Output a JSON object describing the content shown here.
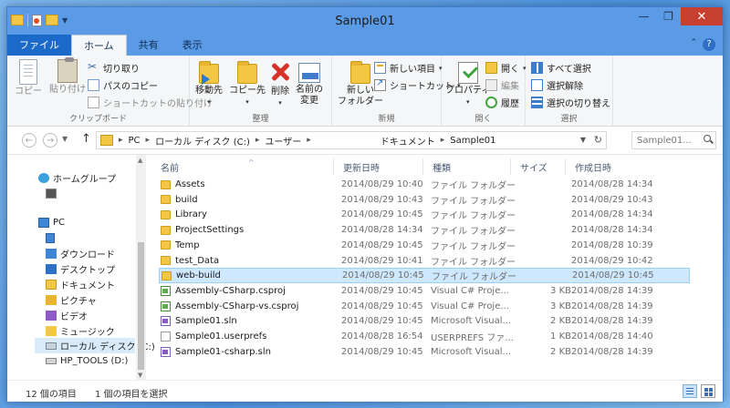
{
  "window": {
    "title": "Sample01",
    "minimize": "—",
    "maximize": "❐",
    "close": "✕"
  },
  "ribbon_tabs": [
    "ファイル",
    "ホーム",
    "共有",
    "表示"
  ],
  "ribbon": {
    "clipboard": {
      "label": "クリップボード",
      "copy": "コピー",
      "paste": "貼り付け",
      "cut": "切り取り",
      "copy_path": "パスのコピー",
      "paste_shortcut": "ショートカットの貼り付け"
    },
    "organize": {
      "label": "整理",
      "move_to": "移動先",
      "copy_to": "コピー先",
      "delete": "削除",
      "rename_1": "名前の",
      "rename_2": "変更"
    },
    "new": {
      "label": "新規",
      "new_folder_1": "新しい",
      "new_folder_2": "フォルダー",
      "new_item": "新しい項目",
      "easy_access": "ショートカット"
    },
    "open": {
      "label": "開く",
      "properties": "プロパティ",
      "open": "開く",
      "edit": "編集",
      "history": "履歴"
    },
    "select": {
      "label": "選択",
      "select_all": "すべて選択",
      "select_none": "選択解除",
      "invert": "選択の切り替え"
    }
  },
  "address": {
    "crumbs": [
      "PC",
      "ローカル ディスク (C:)",
      "ユーザー",
      "ドキュメント",
      "Sample01"
    ],
    "search_placeholder": "Sample01..."
  },
  "nav": {
    "homegroup": "ホームグループ",
    "pc": "PC",
    "downloads": "ダウンロード",
    "desktop": "デスクトップ",
    "documents": "ドキュメント",
    "pictures": "ピクチャ",
    "videos": "ビデオ",
    "music": "ミュージック",
    "local_disk": "ローカル ディスク (C:)",
    "hp_tools": "HP_TOOLS (D:)"
  },
  "columns": {
    "name": "名前",
    "modified": "更新日時",
    "type": "種類",
    "size": "サイズ",
    "created": "作成日時"
  },
  "files": [
    {
      "name": "Assets",
      "modified": "2014/08/29 10:40",
      "type": "ファイル フォルダー",
      "size": "",
      "created": "2014/08/28 14:34",
      "icon": "folder"
    },
    {
      "name": "build",
      "modified": "2014/08/29 10:43",
      "type": "ファイル フォルダー",
      "size": "",
      "created": "2014/08/29 10:43",
      "icon": "folder"
    },
    {
      "name": "Library",
      "modified": "2014/08/29 10:45",
      "type": "ファイル フォルダー",
      "size": "",
      "created": "2014/08/28 14:34",
      "icon": "folder"
    },
    {
      "name": "ProjectSettings",
      "modified": "2014/08/28 14:34",
      "type": "ファイル フォルダー",
      "size": "",
      "created": "2014/08/28 14:34",
      "icon": "folder"
    },
    {
      "name": "Temp",
      "modified": "2014/08/29 10:45",
      "type": "ファイル フォルダー",
      "size": "",
      "created": "2014/08/28 10:39",
      "icon": "folder"
    },
    {
      "name": "test_Data",
      "modified": "2014/08/29 10:41",
      "type": "ファイル フォルダー",
      "size": "",
      "created": "2014/08/29 10:42",
      "icon": "folder"
    },
    {
      "name": "web-build",
      "modified": "2014/08/29 10:45",
      "type": "ファイル フォルダー",
      "size": "",
      "created": "2014/08/29 10:45",
      "icon": "folder",
      "selected": true
    },
    {
      "name": "Assembly-CSharp.csproj",
      "modified": "2014/08/29 10:45",
      "type": "Visual C# Proje...",
      "size": "3 KB",
      "created": "2014/08/28 14:39",
      "icon": "csproj"
    },
    {
      "name": "Assembly-CSharp-vs.csproj",
      "modified": "2014/08/29 10:45",
      "type": "Visual C# Proje...",
      "size": "3 KB",
      "created": "2014/08/28 14:39",
      "icon": "csproj"
    },
    {
      "name": "Sample01.sln",
      "modified": "2014/08/29 10:45",
      "type": "Microsoft Visual...",
      "size": "2 KB",
      "created": "2014/08/28 14:39",
      "icon": "sln"
    },
    {
      "name": "Sample01.userprefs",
      "modified": "2014/08/28 16:54",
      "type": "USERPREFS ファ...",
      "size": "1 KB",
      "created": "2014/08/28 14:40",
      "icon": "blank"
    },
    {
      "name": "Sample01-csharp.sln",
      "modified": "2014/08/29 10:45",
      "type": "Microsoft Visual...",
      "size": "2 KB",
      "created": "2014/08/28 14:39",
      "icon": "sln"
    }
  ],
  "status": {
    "count": "12 個の項目",
    "selected": "1 個の項目を選択"
  }
}
